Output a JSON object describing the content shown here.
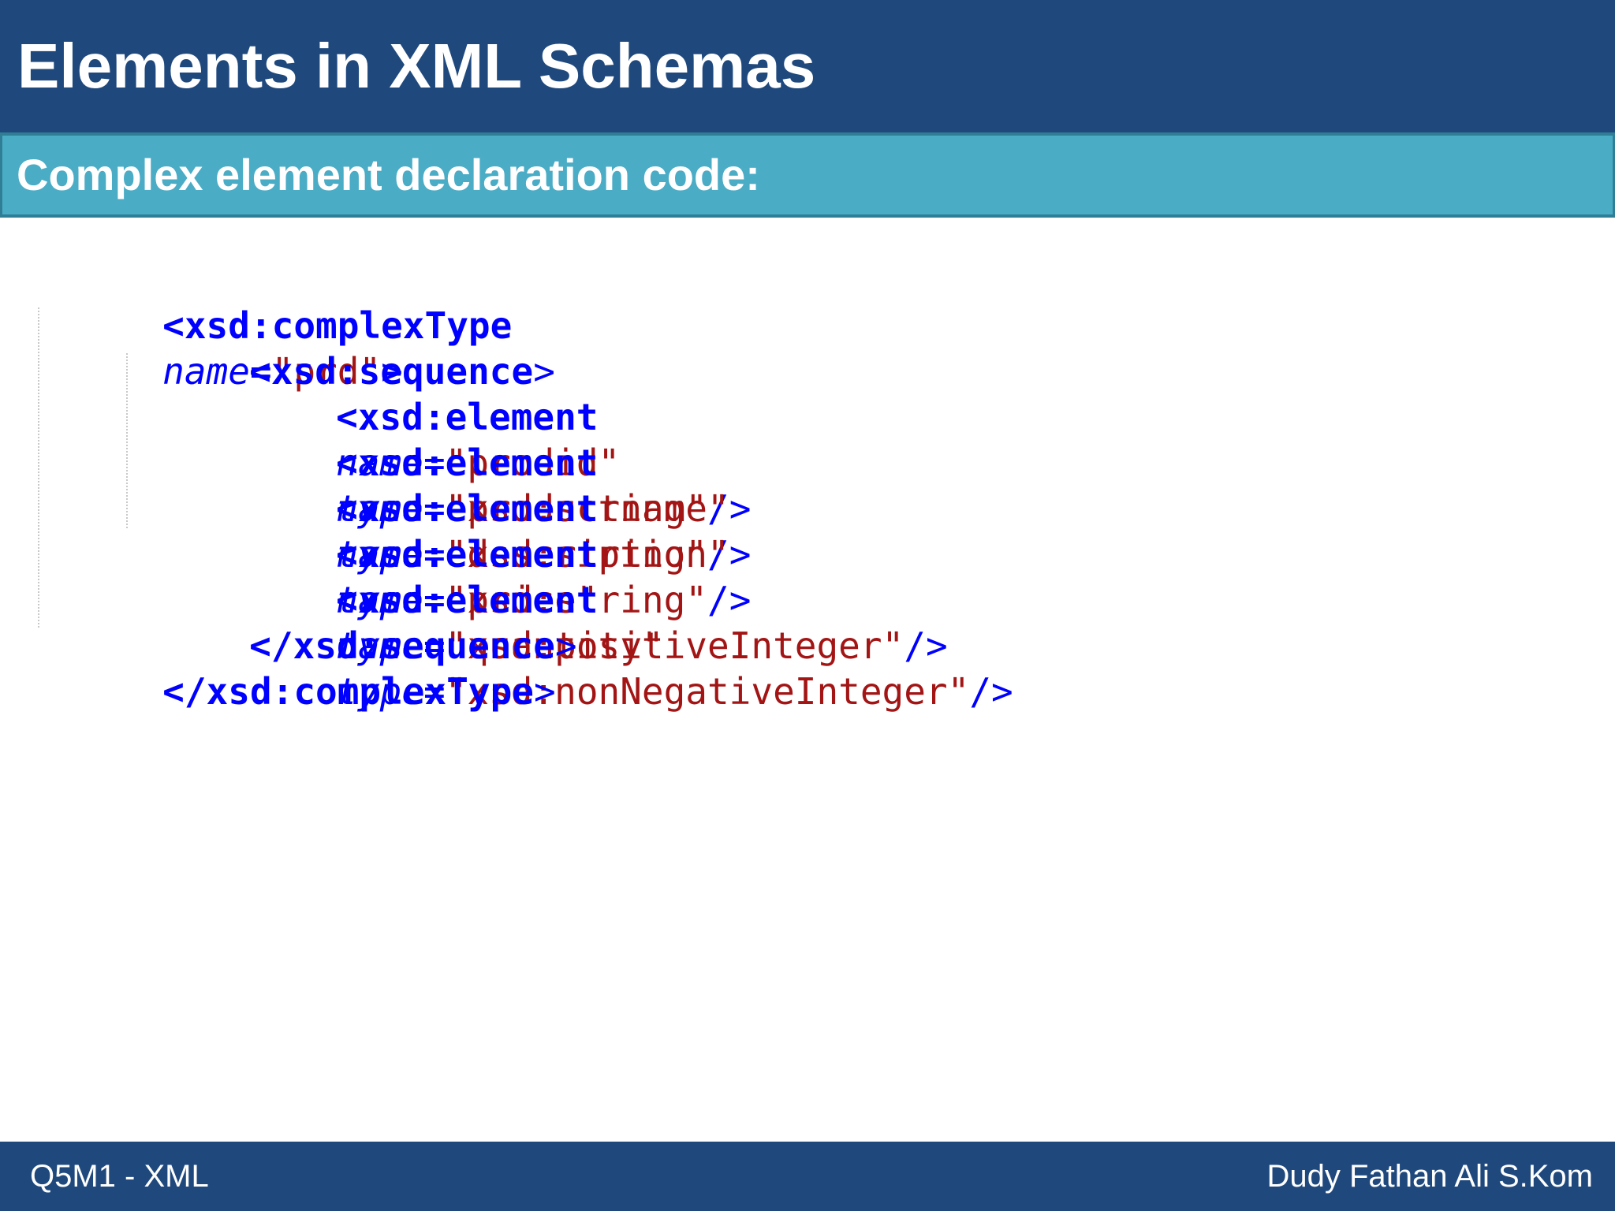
{
  "slide": {
    "title": "Elements in XML Schemas",
    "subtitle": "Complex element declaration code:"
  },
  "code": {
    "lines": [
      {
        "tag": "<xsd:complexType",
        "attrs": [
          {
            "name": "name",
            "value": "\"prd\""
          }
        ],
        "end": ">"
      },
      {
        "tag": "<xsd:sequence",
        "attrs": [],
        "end": ">"
      },
      {
        "tag": "<xsd:element",
        "attrs": [
          {
            "name": "name",
            "value": "\"prodid\""
          },
          {
            "name": "type",
            "value": "\"xsd:string\""
          }
        ],
        "end": "/>"
      },
      {
        "tag": "<xsd:element",
        "attrs": [
          {
            "name": "name",
            "value": "\"productname\""
          },
          {
            "name": "type",
            "value": "\"xsd:string\""
          }
        ],
        "end": "/>"
      },
      {
        "tag": "<xsd:element",
        "attrs": [
          {
            "name": "name",
            "value": "\"description\""
          },
          {
            "name": "type",
            "value": "\"xsd:string\""
          }
        ],
        "end": "/>"
      },
      {
        "tag": "<xsd:element",
        "attrs": [
          {
            "name": "name",
            "value": "\"price\""
          },
          {
            "name": "type",
            "value": "\"xsd:positiveInteger\""
          }
        ],
        "end": "/>"
      },
      {
        "tag": "<xsd:element",
        "attrs": [
          {
            "name": "name",
            "value": "\"quantity\""
          },
          {
            "name": "type",
            "value": "\"xsd:nonNegativeInteger\""
          }
        ],
        "end": "/>"
      },
      {
        "tag": "</xsd:sequence",
        "attrs": [],
        "end": ">"
      },
      {
        "tag": "</xsd:complexType",
        "attrs": [],
        "end": ">"
      }
    ]
  },
  "footer": {
    "left": "Q5M1 - XML",
    "right": "Dudy Fathan Ali S.Kom"
  },
  "colors": {
    "title_bar": "#1f497d",
    "subtitle_bar": "#4bacc6",
    "footer_bar": "#1f497d",
    "code_tag": "#0000ff",
    "code_value": "#a31515"
  }
}
